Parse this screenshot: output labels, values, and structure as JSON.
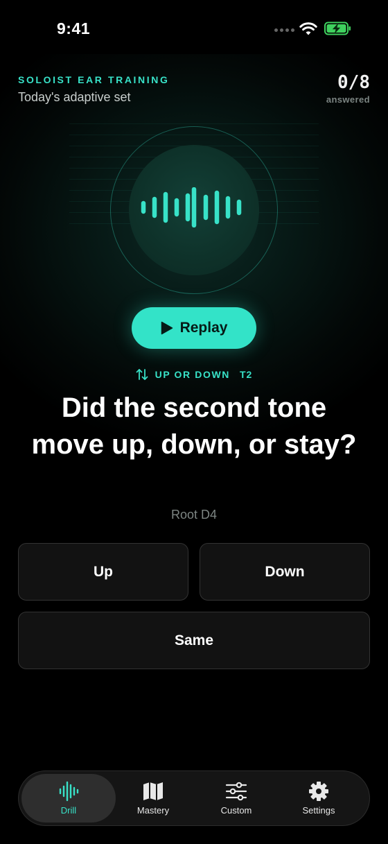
{
  "status_bar": {
    "time": "9:41"
  },
  "header": {
    "brand": "SOLOIST EAR TRAINING",
    "subtitle": "Today's adaptive set",
    "score": "0/8",
    "score_label": "answered"
  },
  "player": {
    "replay_label": "Replay"
  },
  "prompt": {
    "category": "UP OR DOWN",
    "tag": "T2",
    "question": "Did the second tone move up, down, or stay?",
    "root": "Root D4"
  },
  "answers": [
    {
      "label": "Up"
    },
    {
      "label": "Down"
    },
    {
      "label": "Same"
    }
  ],
  "tabs": [
    {
      "label": "Drill",
      "icon": "waveform-icon",
      "active": true
    },
    {
      "label": "Mastery",
      "icon": "map-icon",
      "active": false
    },
    {
      "label": "Custom",
      "icon": "sliders-icon",
      "active": false
    },
    {
      "label": "Settings",
      "icon": "gear-icon",
      "active": false
    }
  ],
  "colors": {
    "accent": "#38e2c8",
    "background": "#000000",
    "card": "#121212"
  }
}
